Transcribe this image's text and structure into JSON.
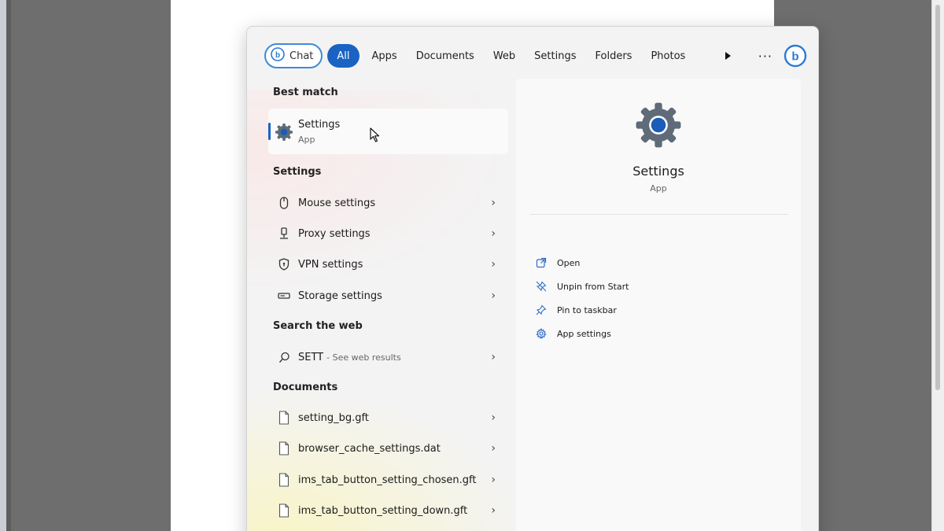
{
  "filter_bar": {
    "chat_label": "Chat",
    "tabs": [
      "All",
      "Apps",
      "Documents",
      "Web",
      "Settings",
      "Folders",
      "Photos"
    ],
    "more_label": "···"
  },
  "best_match": {
    "title": "Best match",
    "name": "Settings",
    "type": "App"
  },
  "settings_section": {
    "title": "Settings",
    "items": [
      {
        "label": "Mouse settings",
        "icon": "mouse-icon"
      },
      {
        "label": "Proxy settings",
        "icon": "proxy-icon"
      },
      {
        "label": "VPN settings",
        "icon": "shield-icon"
      },
      {
        "label": "Storage settings",
        "icon": "storage-icon"
      }
    ]
  },
  "web_section": {
    "title": "Search the web",
    "query": "SETT",
    "sub": "- See web results"
  },
  "documents_section": {
    "title": "Documents",
    "items": [
      {
        "label": "setting_bg.gft"
      },
      {
        "label": "browser_cache_settings.dat"
      },
      {
        "label": "ims_tab_button_setting_chosen.gft"
      },
      {
        "label": "ims_tab_button_setting_down.gft"
      }
    ]
  },
  "preview": {
    "title": "Settings",
    "sub": "App",
    "actions": [
      {
        "label": "Open",
        "icon": "open-icon"
      },
      {
        "label": "Unpin from Start",
        "icon": "unpin-icon"
      },
      {
        "label": "Pin to taskbar",
        "icon": "pin-icon"
      },
      {
        "label": "App settings",
        "icon": "gear-icon"
      }
    ]
  },
  "colors": {
    "accent": "#1a63c2",
    "gear": "#5f6b78"
  }
}
